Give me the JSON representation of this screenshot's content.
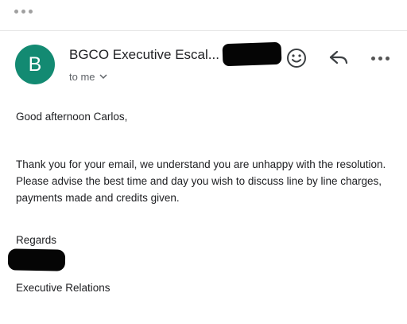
{
  "header": {
    "avatar_letter": "B",
    "sender_name": "BGCO Executive Escal...",
    "recipient": "to me",
    "avatar_color": "#138a72"
  },
  "toolbar": {
    "icons": [
      "more-horizontal-icon",
      "emoji-icon",
      "reply-icon",
      "more-horizontal-icon"
    ]
  },
  "message": {
    "greeting": "Good afternoon Carlos,",
    "paragraph": "Thank you for your email, we understand you are unhappy with the resolution. Please advise the best time and day you wish to discuss line by line charges, payments made and credits given.",
    "regards": "Regards",
    "team": "Executive Relations"
  }
}
